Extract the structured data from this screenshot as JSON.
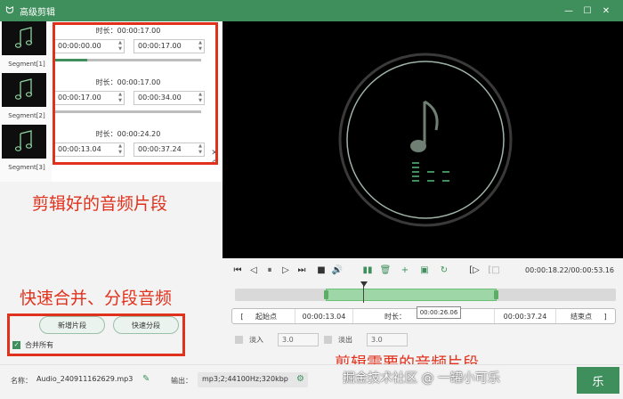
{
  "window": {
    "title": "高级剪辑",
    "app_icon": "rabbit-logo-icon",
    "minimize_icon": "minimize-icon",
    "maximize_icon": "maximize-icon",
    "close_icon": "close-icon"
  },
  "segments": [
    {
      "thumb_label": "Segment[1]",
      "duration": "时长：00:00:17.00",
      "start": "00:00:00.00",
      "end": "00:00:17.00"
    },
    {
      "thumb_label": "Segment[2]",
      "duration": "时长：00:00:17.00",
      "start": "00:00:17.00",
      "end": "00:00:34.00"
    },
    {
      "thumb_label": "Segment[3]",
      "duration": "时长：00:00:24.20",
      "start": "00:00:13.04",
      "end": "00:00:37.24"
    }
  ],
  "annotations": {
    "segments_note": "剪辑好的音频片段",
    "merge_note": "快速合并、分段音频",
    "range_note": "剪辑需要的音频片段"
  },
  "left_actions": {
    "add_segment": "新增片段",
    "quick_split": "快速分段",
    "merge_all": "合并所有"
  },
  "player": {
    "time_display": "00:00:18.22/00:00:53.16",
    "bracket_left": "[",
    "bracket_right": "]",
    "start_label": "起始点",
    "start_value": "00:00:13.04",
    "duration_label": "时长：",
    "end_value": "00:00:37.24",
    "end_label": "结束点",
    "tooltip": "00:00:26.06",
    "fade_in_label": "淡入",
    "fade_in_value": "3.0",
    "fade_out_label": "淡出",
    "fade_out_value": "3.0"
  },
  "bottom": {
    "name_label": "名称：",
    "name_value": "Audio_240911162629.mp3",
    "output_label": "输出：",
    "output_value": "mp3;2;44100Hz;320kbp",
    "watermark": "掘金技术社区 @ 一罐小可乐",
    "corner_button": "乐"
  },
  "colors": {
    "accent": "#3f8f5d",
    "annotation": "#e0311c",
    "selection": "#9fd6a7"
  }
}
